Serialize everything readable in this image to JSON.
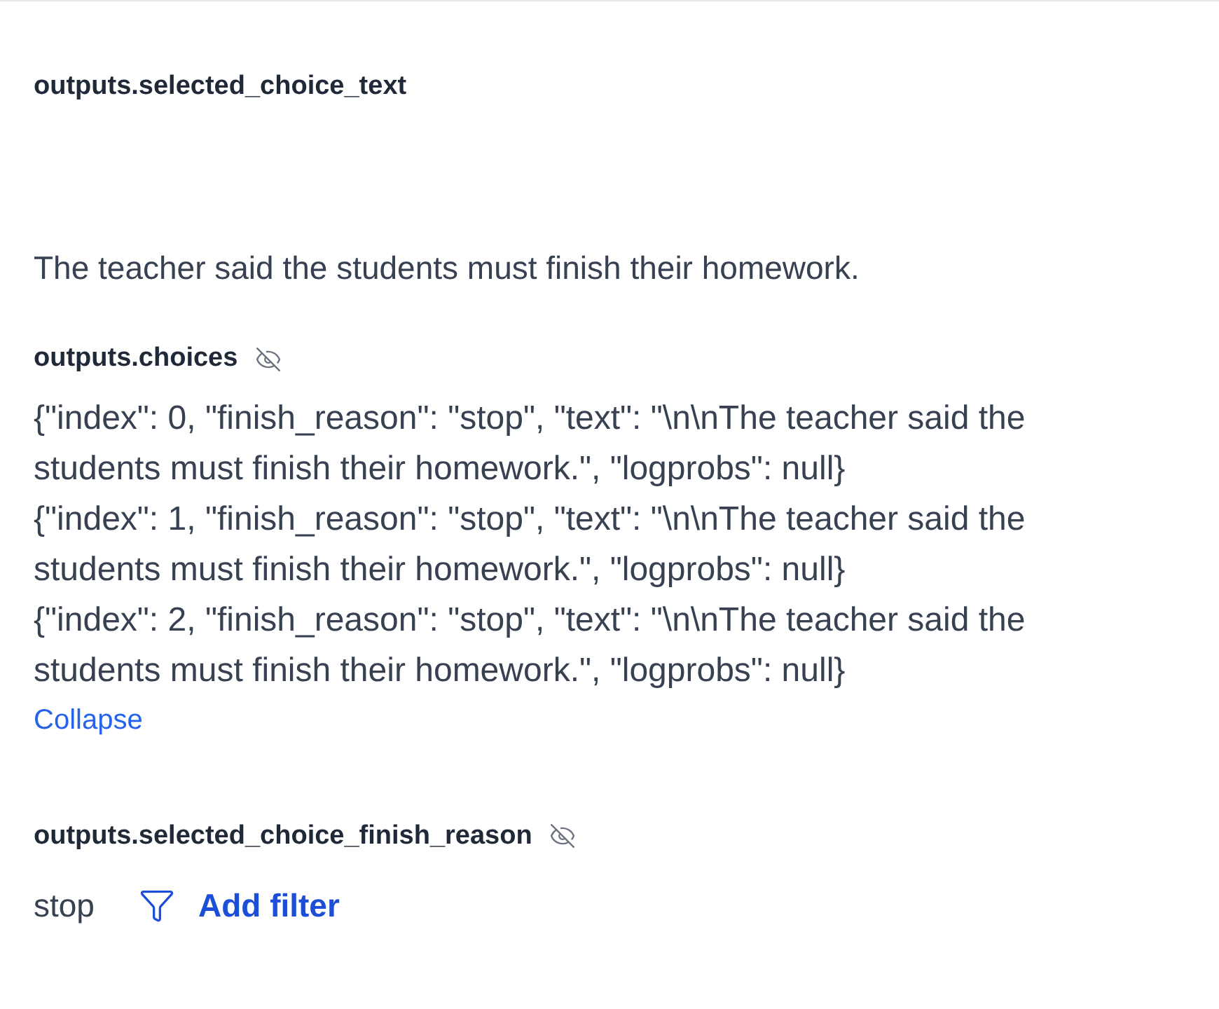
{
  "fields": [
    {
      "kind": "text",
      "label": "outputs.selected_choice_text",
      "eye_off": false,
      "value": "The teacher said the students must finish their homework."
    },
    {
      "kind": "list",
      "label": "outputs.choices",
      "eye_off": true,
      "values": [
        "{\"index\": 0, \"finish_reason\": \"stop\", \"text\": \"\\n\\nThe teacher said the students must finish their homework.\", \"logprobs\": null}",
        "{\"index\": 1, \"finish_reason\": \"stop\", \"text\": \"\\n\\nThe teacher said the students must finish their homework.\", \"logprobs\": null}",
        "{\"index\": 2, \"finish_reason\": \"stop\", \"text\": \"\\n\\nThe teacher said the students must finish their homework.\", \"logprobs\": null}"
      ],
      "toggle": "Collapse"
    },
    {
      "kind": "filterable",
      "label": "outputs.selected_choice_finish_reason",
      "eye_off": true,
      "value": "stop",
      "action": "Add filter"
    }
  ]
}
